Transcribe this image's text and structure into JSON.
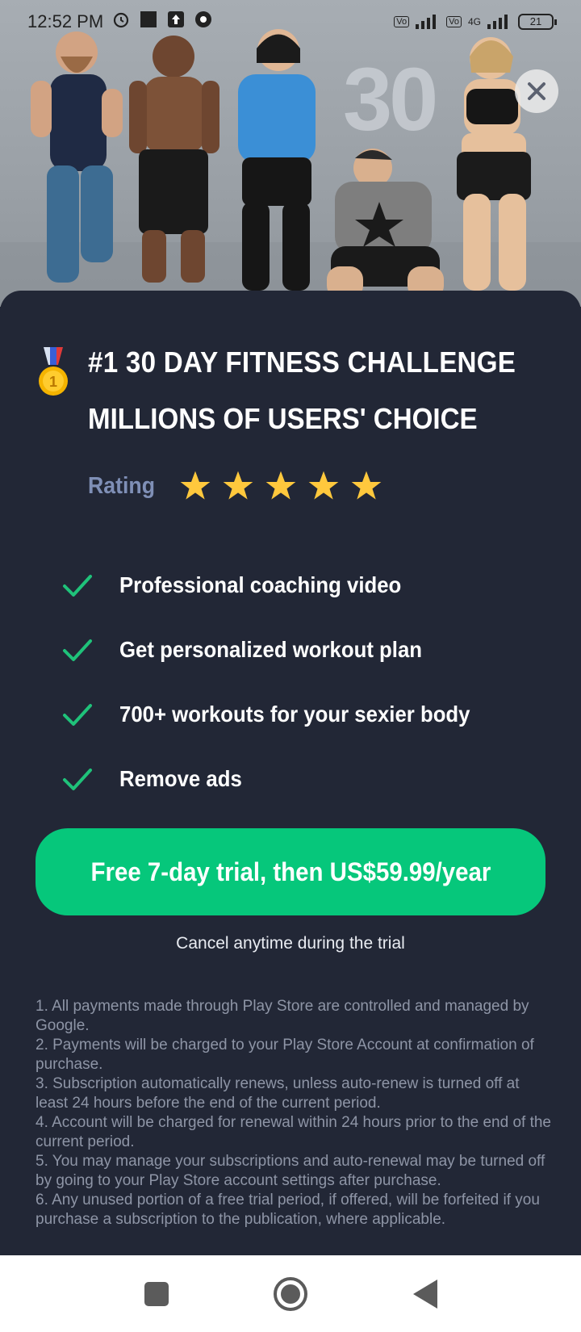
{
  "status_bar": {
    "time": "12:52 PM",
    "icons": [
      "alarm-icon",
      "notification-square-icon",
      "upload-icon",
      "chrome-icon"
    ],
    "network_1": "Vo LTE",
    "network_2": "4G",
    "battery": "21"
  },
  "hero": {
    "wall_number": "30",
    "close_icon": "close-icon"
  },
  "panel": {
    "medal_icon": "medal-icon",
    "title_line1": "#1 30 DAY FITNESS CHALLENGE",
    "title_line2": "MILLIONS OF USERS' CHOICE",
    "rating_label": "Rating",
    "rating_stars": 5,
    "star_color": "#ffc83d",
    "features": [
      {
        "icon": "check-icon",
        "label": "Professional coaching video"
      },
      {
        "icon": "check-icon",
        "label": "Get personalized workout plan"
      },
      {
        "icon": "check-icon",
        "label": "700+ workouts for your sexier body"
      },
      {
        "icon": "check-icon",
        "label": "Remove ads"
      }
    ],
    "check_color": "#1fc27a",
    "cta_label": "Free 7-day trial, then US$59.99/year",
    "cta_color": "#06c77b",
    "cancel_note": "Cancel anytime during the trial",
    "terms": [
      "1. All payments made through Play Store are controlled and managed by Google.",
      "2. Payments will be charged to your Play Store Account at confirmation of purchase.",
      "3. Subscription automatically renews, unless auto-renew is turned off at least 24 hours before the end of the current period.",
      "4. Account will be charged for renewal within 24 hours prior to the end of the current period.",
      "5. You may manage your subscriptions and auto-renewal may be turned off by going to your Play Store account settings after purchase.",
      "6. Any unused portion of a free trial period, if offered, will be forfeited if you purchase a subscription to the publication, where applicable."
    ]
  },
  "nav_bar": {
    "recents_icon": "square-recents-icon",
    "home_icon": "circle-home-icon",
    "back_icon": "triangle-back-icon"
  },
  "colors": {
    "background": "#222736",
    "rating_label": "#7f8fb6",
    "terms_text": "#8e95a6"
  }
}
